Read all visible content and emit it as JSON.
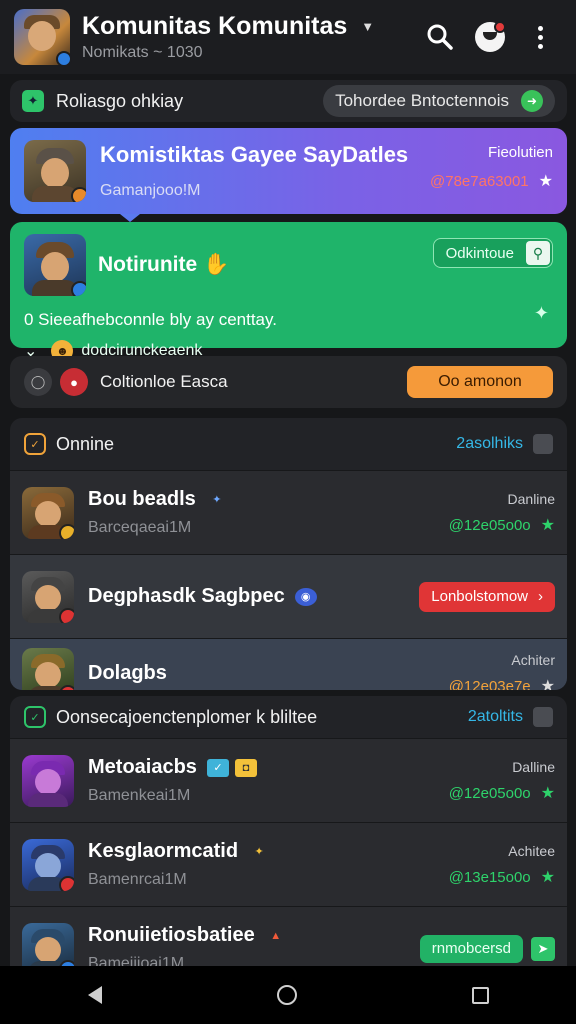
{
  "header": {
    "title": "Komunitas Komunitas",
    "subtitle": "Nomikats ~ 1030",
    "icons": [
      "dropdown-chevron-icon",
      "search-icon",
      "notification-icon",
      "more-vert-icon"
    ]
  },
  "promo": {
    "title": "Roliasgo ohkiay",
    "pill_label": "Tohordee Bntoctennois"
  },
  "featured": {
    "title": "Komistiktas Gayee SayDatles",
    "subtitle": "Gamanjooo!M",
    "status": "Fieolutien",
    "code": "@78e7a63001"
  },
  "announce": {
    "title": "Notirunite",
    "button_label": "Odkintoue",
    "description": "0 Sieeafhebconnle bly ay centtay.",
    "footer_text": "dodcirunckeaenk"
  },
  "action_bar": {
    "label": "Coltionloe Easca",
    "button_label": "Oo amonon"
  },
  "online_section": {
    "title": "Onnine",
    "link": "2asolhiks",
    "items": [
      {
        "name": "Bou beadls",
        "sub": "Barceqaeai1M",
        "status": "Danline",
        "code": "@12e05o0o"
      },
      {
        "name": "Degphasdk Sagbpec",
        "button_label": "Lonbolstomow"
      },
      {
        "name": "Dolagbs",
        "status": "Achiter",
        "code": "@12e03e7e"
      }
    ]
  },
  "second_section": {
    "title": "Oonsecajoenctenplomer k bliltee",
    "link": "2atoltits",
    "items": [
      {
        "name": "Metoaiacbs",
        "sub": "Bamenkeai1M",
        "status": "Dalline",
        "code": "@12e05o0o"
      },
      {
        "name": "Kesglaormcatid",
        "sub": "Bamenrcai1M",
        "status": "Achitee",
        "code": "@13e15o0o"
      },
      {
        "name": "Ronuiietiosbatiee",
        "sub": "Bameiiioai1M",
        "button_label": "rnmobcersd"
      }
    ]
  }
}
